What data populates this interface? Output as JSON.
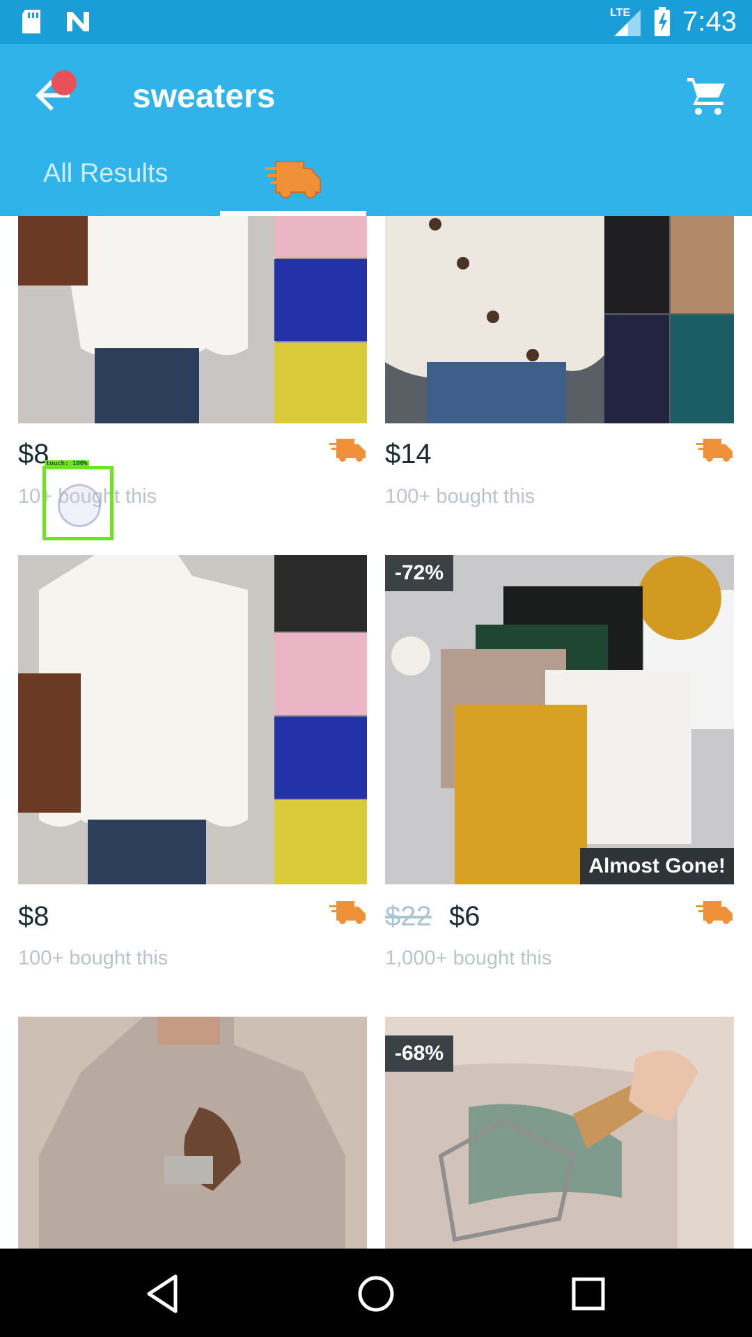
{
  "status_bar": {
    "time": "7:43",
    "network": "LTE"
  },
  "app_bar": {
    "title": "sweaters",
    "tabs": [
      {
        "label": "All Results"
      },
      {
        "label": ""
      }
    ]
  },
  "products": [
    {
      "price": "$8",
      "sold": "10+ bought this",
      "discount": "",
      "old_price": ""
    },
    {
      "price": "$14",
      "sold": "100+ bought this",
      "discount": "",
      "old_price": ""
    },
    {
      "price": "$8",
      "sold": "100+ bought this",
      "discount": "",
      "old_price": ""
    },
    {
      "price": "$6",
      "sold": "1,000+ bought this",
      "discount": "-72%",
      "old_price": "$22",
      "badge": "Almost Gone!"
    },
    {
      "price": "",
      "sold": "",
      "discount": "",
      "old_price": ""
    },
    {
      "price": "",
      "sold": "",
      "discount": "-68%",
      "old_price": ""
    }
  ],
  "overlay": {
    "touch_label": "touch: 100%"
  },
  "colors": {
    "app_bar": "#2fb3e8",
    "status_bar": "#1a9ed7",
    "fast_shipping": "#f0913a",
    "notification": "#e8505a"
  }
}
